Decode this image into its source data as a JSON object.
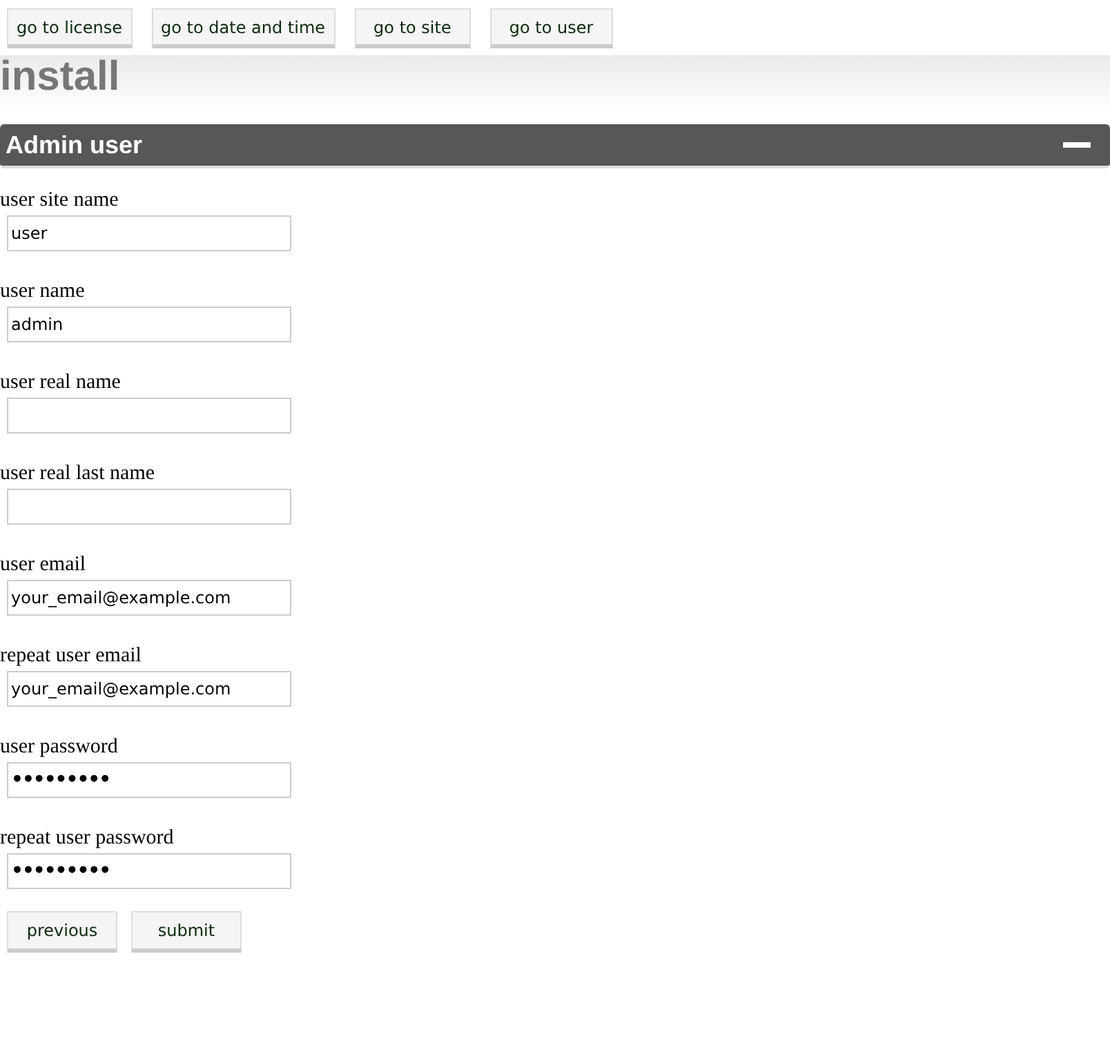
{
  "nav_buttons": [
    "go to license",
    "go to date and time",
    "go to site",
    "go to user"
  ],
  "title": "install",
  "section": {
    "title": "Admin user",
    "expanded": true
  },
  "fields": [
    {
      "label": "user site name",
      "kind": "text",
      "value": "user"
    },
    {
      "label": "user name",
      "kind": "text",
      "value": "admin"
    },
    {
      "label": "user real name",
      "kind": "text"
    },
    {
      "label": "user real last name",
      "kind": "text"
    },
    {
      "label": "user email",
      "kind": "text",
      "value": "your_email@example.com"
    },
    {
      "label": "repeat user email",
      "kind": "text",
      "value": "your_email@example.com"
    },
    {
      "label": "user password",
      "kind": "password",
      "value": "•••••••••"
    },
    {
      "label": "repeat user password",
      "kind": "password",
      "value": "•••••••••"
    }
  ],
  "buttons": [
    "previous",
    "submit"
  ]
}
